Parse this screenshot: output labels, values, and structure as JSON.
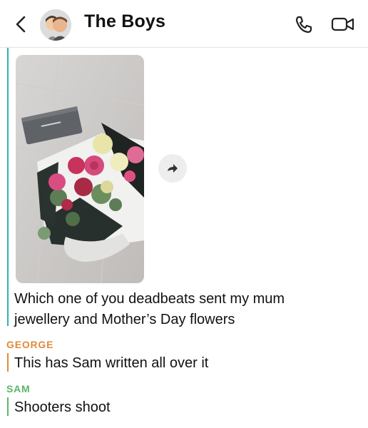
{
  "header": {
    "title": "The Boys",
    "icons": [
      "back-chevron-icon",
      "group-avatar",
      "phone-icon",
      "video-camera-icon"
    ]
  },
  "messages": [
    {
      "sender": "",
      "type": "photo",
      "bar_color": "#2bb6a8"
    },
    {
      "sender": "",
      "type": "text",
      "text": "Which one of you deadbeats sent my mum jewellery and Mother’s Day flowers",
      "bar_color": "#2bb6a8"
    },
    {
      "sender": "GEORGE",
      "type": "text",
      "text": "This has Sam written all over it",
      "sender_color": "#e08a3b"
    },
    {
      "sender": "SAM",
      "type": "text",
      "text": "Shooters shoot",
      "sender_color": "#5bb56a"
    }
  ],
  "colors": {
    "me": "#2bb6a8",
    "george": "#e08a3b",
    "sam": "#5bb56a"
  }
}
